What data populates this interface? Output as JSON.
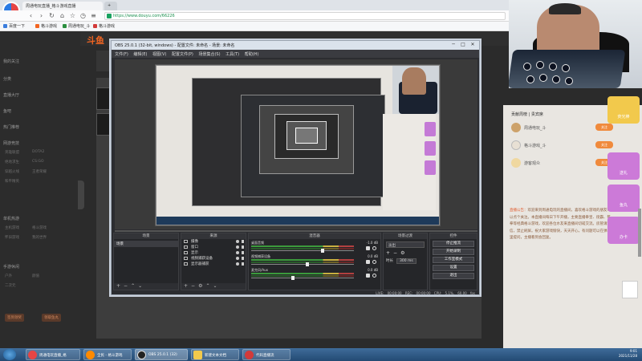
{
  "browser": {
    "badge": "已开播放",
    "tabs": [
      {
        "label": "周通电玩直播_格斗游戏直播"
      },
      {
        "label": "+"
      }
    ],
    "url": "https://www.douyu.com/66226",
    "bookmarks": [
      {
        "label": "百度一下",
        "color": "#3b7ddd"
      },
      {
        "label": "格斗游戏",
        "color": "#f26522"
      },
      {
        "label": "周通电玩_斗",
        "color": "#2b8f3f"
      },
      {
        "label": "格斗游戏",
        "color": "#d23a3a"
      }
    ]
  },
  "douyu": {
    "logo": "斗鱼",
    "left_nav": {
      "items": [
        {
          "label": "我的关注"
        },
        {
          "label": "分类"
        },
        {
          "label": "直播大厅"
        },
        {
          "label": "鱼吧"
        },
        {
          "label": "热门推荐"
        }
      ],
      "sections": [
        {
          "title": "网游竞技",
          "items": [
            "英雄联盟",
            "DOTA2",
            "绝地求生",
            "CS:GO",
            "穿越火线",
            "王者荣耀",
            "和平精英"
          ]
        },
        {
          "title": "单机热游",
          "items": [
            "主机游戏",
            "格斗游戏",
            "怀旧游戏",
            "我的世界"
          ]
        },
        {
          "title": "手游休闲",
          "items": [
            "户外",
            "颜值",
            "二次元"
          ]
        }
      ],
      "buttons": [
        "签到领奖",
        "领取鱼丸"
      ]
    },
    "chat": {
      "title": "贡献周榜 | 贵宾席",
      "rows": [
        {
          "name": "周通电玩_斗",
          "btn": "关注"
        },
        {
          "name": "格斗游戏_斗",
          "btn": "关注"
        },
        {
          "name": "游客观众",
          "btn": "关注"
        }
      ],
      "notice_head": "直播公告：",
      "notice": "欢迎来到周通电玩的直播间，喜欢格斗游戏的朋友可以点个关注。本直播间每日下午开播，主要直播拳皇、街霸、铁拳等经典格斗游戏，欢迎各位水友来直播间切磋交流。房管请私信，禁止刷屏。祝大家游戏愉快，天天开心，有问题可以在弹幕里提问，主播看到会回复。"
    },
    "gifts": [
      {
        "label": "荧光棒"
      },
      {
        "label": "送礼"
      },
      {
        "label": "鱼丸"
      },
      {
        "label": "办卡"
      }
    ]
  },
  "obs": {
    "title": "OBS 25.0.1 (32-bit, windows) - 配置文件: 未命名 - 场景: 未命名",
    "menu": [
      "文件(F)",
      "编辑(E)",
      "视图(V)",
      "配置文件(P)",
      "场景集合(S)",
      "工具(T)",
      "帮助(H)"
    ],
    "docks": {
      "scenes": {
        "title": "场景",
        "items": [
          "场景"
        ]
      },
      "sources": {
        "title": "来源",
        "items": [
          "摄像",
          "窗口",
          "显示",
          "视频捕获设备",
          "显示器捕获"
        ]
      },
      "mixer": {
        "title": "混音器",
        "channels": [
          {
            "name": "桌面音频",
            "db": "-1.0 dB",
            "level": 0.7
          },
          {
            "name": "视频捕获设备",
            "db": "0.0 dB",
            "level": 0.55
          },
          {
            "name": "麦克风/Aux",
            "db": "0.0 dB",
            "level": 0.4
          }
        ]
      },
      "transitions": {
        "title": "场景过渡",
        "selected": "淡出",
        "duration_label": "时长",
        "duration": "300 ms"
      },
      "controls": {
        "title": "控件",
        "buttons": [
          "停止推流",
          "开始录制",
          "工作室模式",
          "设置",
          "退出"
        ]
      }
    },
    "status": "LIVE: 00:00:00    REC: 00:00:00    CPU: 5.1%, 60.00 fps"
  },
  "taskbar": {
    "items": [
      {
        "label": "周通电玩直播_格",
        "color": "#e64545"
      },
      {
        "label": "全民 - 格斗游戏",
        "color": "#ff8a00"
      },
      {
        "label": "OBS 25.0.1 (32)",
        "color": "#222"
      },
      {
        "label": "新建文本文档",
        "color": "#f2c94c"
      },
      {
        "label": "代码直播流",
        "color": "#d23a3a"
      }
    ],
    "time": "9:01",
    "date": "2021/11/28"
  },
  "colors": {
    "accent": "#f26522",
    "obs_bg": "#2b2c30",
    "taskbar": "#2f5d8c"
  }
}
